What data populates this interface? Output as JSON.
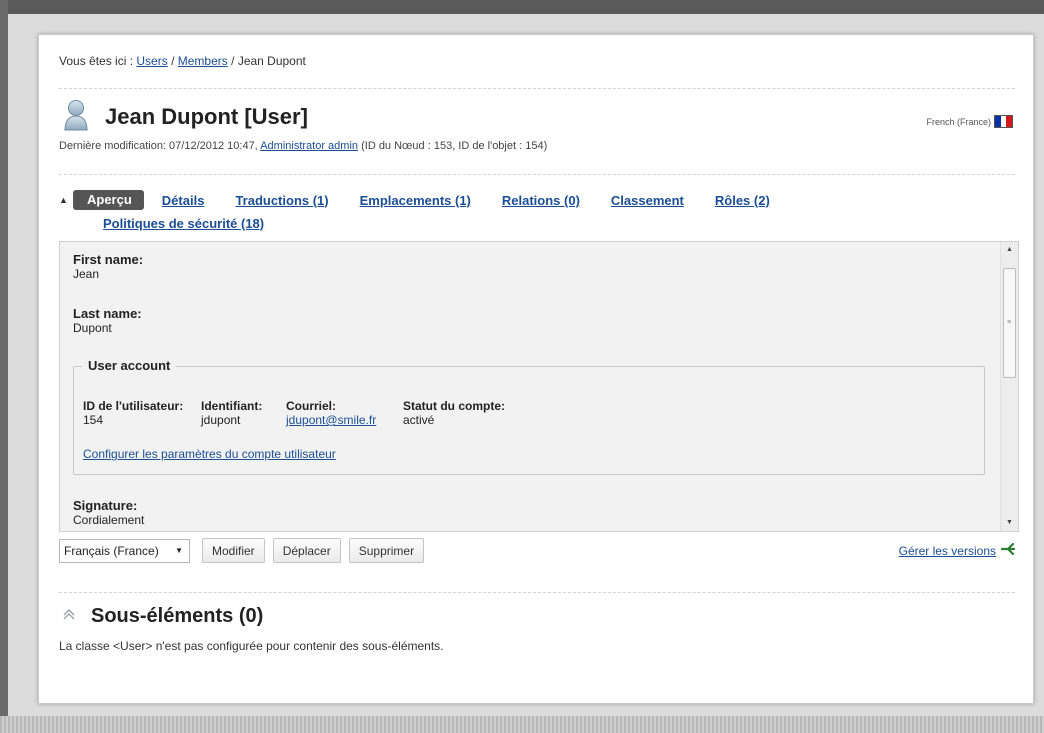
{
  "breadcrumb": {
    "prefix": "Vous êtes ici :",
    "items": [
      "Users",
      "Members"
    ],
    "current": "Jean Dupont",
    "separator": "/"
  },
  "header": {
    "title": "Jean Dupont [User]",
    "meta_prefix": "Dernière modification: 07/12/2012 10:47,",
    "meta_author": "Administrator admin",
    "meta_suffix": "(ID du Nœud : 153, ID de l'objet : 154)",
    "language_label": "French (France)"
  },
  "tabs": {
    "active": "Aperçu",
    "links": [
      "Détails",
      "Traductions (1)",
      "Emplacements (1)",
      "Relations (0)",
      "Classement",
      "Rôles (2)"
    ],
    "second_row": "Politiques de sécurité (18)"
  },
  "content": {
    "first_name": {
      "label": "First name:",
      "value": "Jean"
    },
    "last_name": {
      "label": "Last name:",
      "value": "Dupont"
    },
    "user_account": {
      "legend": "User account",
      "columns": [
        {
          "label": "ID de l'utilisateur:",
          "value": "154"
        },
        {
          "label": "Identifiant:",
          "value": "jdupont"
        },
        {
          "label": "Courriel:",
          "value": "jdupont@smile.fr"
        },
        {
          "label": "Statut du compte:",
          "value": "activé"
        }
      ],
      "config_link": "Configurer les paramètres du compte utilisateur"
    },
    "signature": {
      "label": "Signature:",
      "value": "Cordialement"
    }
  },
  "actions": {
    "language_select": "Français (France)",
    "buttons": [
      "Modifier",
      "Déplacer",
      "Supprimer"
    ],
    "versions_link": "Gérer les versions"
  },
  "subitems": {
    "title": "Sous-éléments (0)",
    "text": "La classe <User> n'est pas configurée pour contenir des sous-éléments."
  },
  "colors": {
    "link": "#1a4e96",
    "active_tab_bg": "#555555",
    "flag": [
      "#0a2fa8",
      "#ffffff",
      "#d4161d"
    ]
  }
}
